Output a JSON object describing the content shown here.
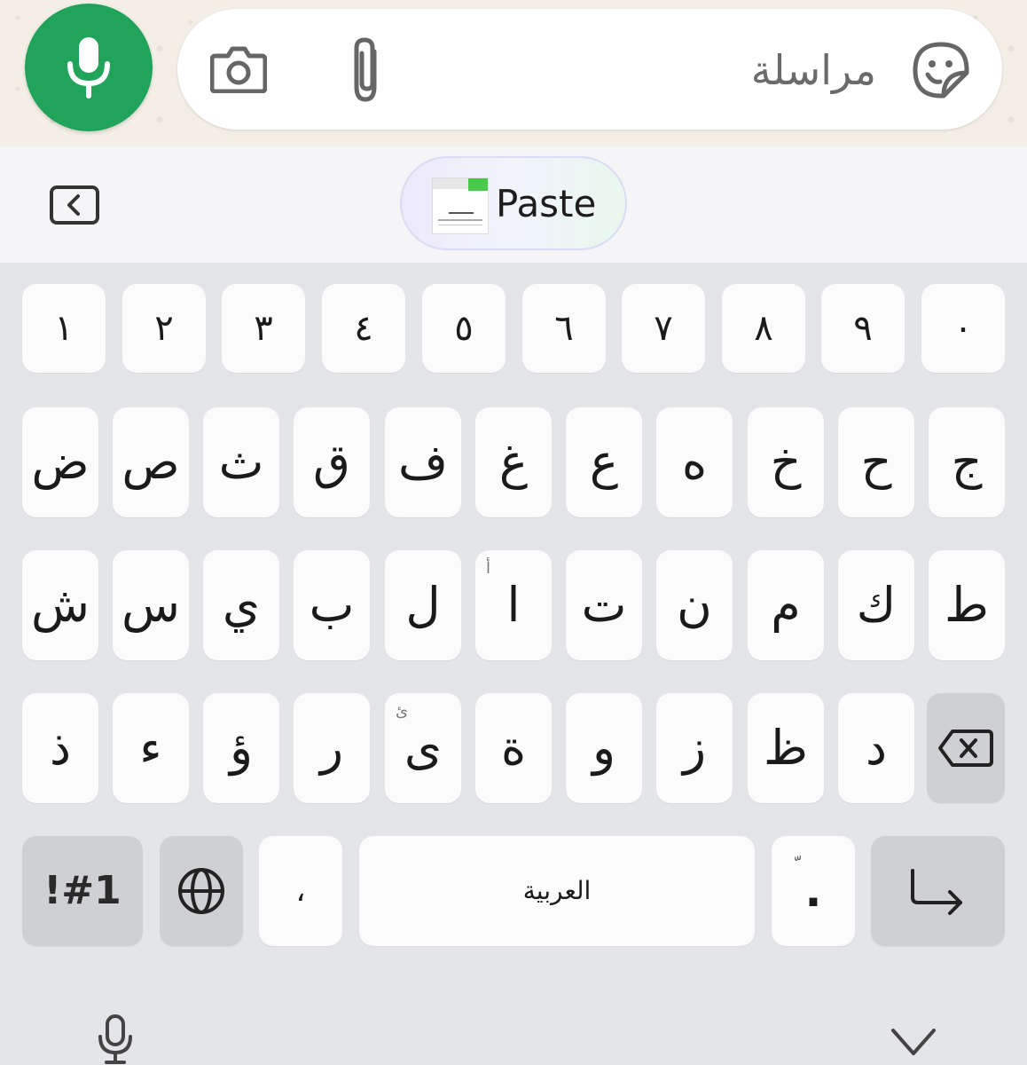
{
  "chat": {
    "placeholder": "مراسلة",
    "accent_color": "#21a35b",
    "icons": {
      "mic": "microphone-icon",
      "camera": "camera-icon",
      "attach": "paperclip-icon",
      "sticker": "sticker-emoji-icon"
    }
  },
  "suggestion": {
    "paste_label": "Paste",
    "back_icon": "back-chevron-icon"
  },
  "keyboard": {
    "number_row": [
      "١",
      "٢",
      "٣",
      "٤",
      "٥",
      "٦",
      "٧",
      "٨",
      "٩",
      "٠"
    ],
    "row1": [
      "ض",
      "ص",
      "ث",
      "ق",
      "ف",
      "غ",
      "ع",
      "ه",
      "خ",
      "ح",
      "ج"
    ],
    "row2": [
      "ش",
      "س",
      "ي",
      "ب",
      "ل",
      "ا",
      "ت",
      "ن",
      "م",
      "ك",
      "ط"
    ],
    "row2_hint_alef": "أ",
    "row3": [
      "ذ",
      "ء",
      "ؤ",
      "ر",
      "ى",
      "ة",
      "و",
      "ز",
      "ظ",
      "د"
    ],
    "row3_hint_yeh": "ئ",
    "bottom": {
      "symbols": "!#1",
      "comma": "،",
      "space": "العربية",
      "period": ".",
      "period_hint": "ّ"
    },
    "icons": {
      "backspace": "backspace-icon",
      "globe": "globe-icon",
      "enter": "enter-icon",
      "voice": "microphone-icon",
      "hide": "chevron-down-icon"
    }
  }
}
